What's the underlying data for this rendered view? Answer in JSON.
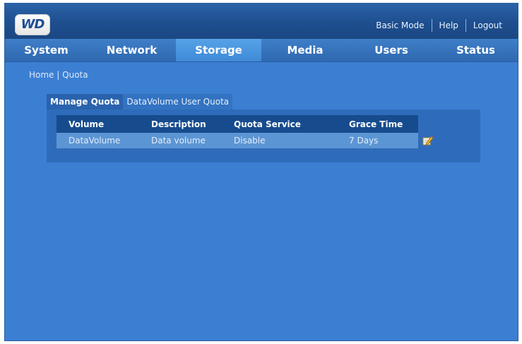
{
  "header": {
    "logo_text": "WD",
    "links": [
      "Basic Mode",
      "Help",
      "Logout"
    ]
  },
  "nav": {
    "tabs": [
      "System",
      "Network",
      "Storage",
      "Media",
      "Users",
      "Status"
    ],
    "active": "Storage"
  },
  "breadcrumb": {
    "home": "Home",
    "separator": "|",
    "current": "Quota"
  },
  "subtabs": {
    "manage": "Manage Quota",
    "user": "DataVolume User Quota"
  },
  "table": {
    "headers": [
      "Volume",
      "Description",
      "Quota Service",
      "Grace Time"
    ],
    "rows": [
      [
        "DataVolume",
        "Data volume",
        "Disable",
        "7 Days"
      ]
    ]
  },
  "icons": {
    "edit": "edit-icon"
  },
  "colors": {
    "background": "#3b7fd3",
    "header": "#1e4f8f",
    "active_tab": "#4d96de",
    "table_header": "#164c8e",
    "table_row": "#5c95d3"
  }
}
